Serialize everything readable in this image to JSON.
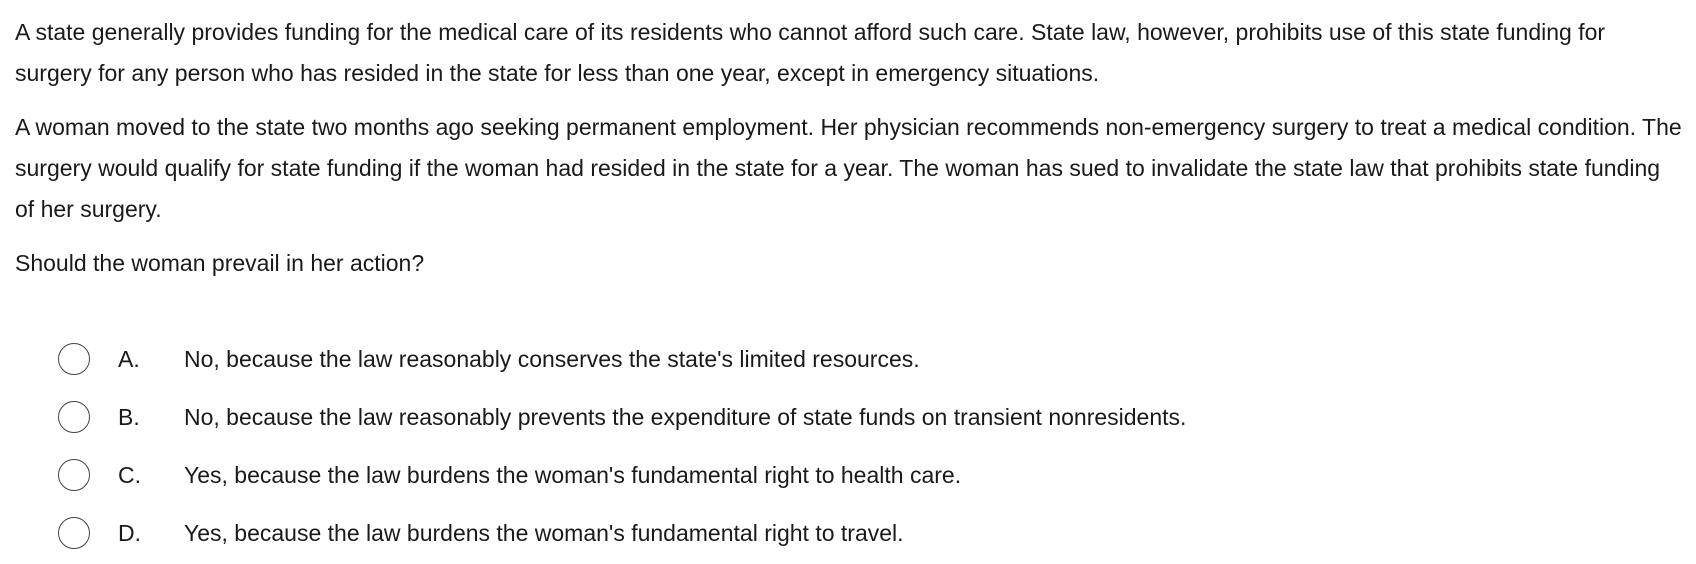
{
  "question": {
    "paragraphs": [
      "A state generally provides funding for the medical care of its residents who cannot afford such care.  State law, however, prohibits use of this state funding for surgery for any person who has resided in the state for less than one year, except in emergency situations.",
      "A woman moved to the state two months ago seeking permanent employment.  Her physician recommends non-emergency surgery to treat a medical condition.  The surgery would qualify for state funding if the woman had resided in the state for a year.  The woman has sued to invalidate the state law that prohibits state funding of her surgery."
    ],
    "stem": "Should the woman prevail in her action?"
  },
  "options": [
    {
      "letter": "A.",
      "text": "No, because the law reasonably conserves the state's limited resources."
    },
    {
      "letter": "B.",
      "text": "No, because the law reasonably prevents the expenditure of state funds on transient nonresidents."
    },
    {
      "letter": "C.",
      "text": "Yes, because the law burdens the woman's fundamental right to health care."
    },
    {
      "letter": "D.",
      "text": "Yes, because the law burdens the woman's fundamental right to travel."
    }
  ]
}
